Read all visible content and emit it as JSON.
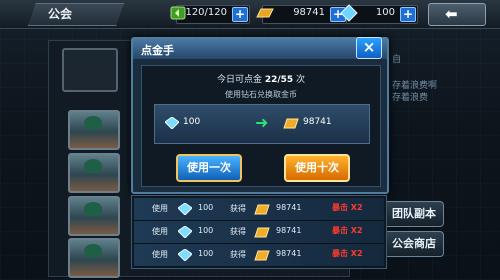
{
  "topbar": {
    "title": "公会",
    "stamina": "120/120",
    "gold": "98741",
    "diamond": "100",
    "plus": "+"
  },
  "background": {
    "faded_lines": [
      "自",
      "存着浪费啊",
      "存着浪费"
    ]
  },
  "side_buttons": {
    "team_dungeon": "团队副本",
    "guild_shop": "公会商店"
  },
  "dialog": {
    "title": "点金手",
    "close": "×",
    "today_label": "今日可点金",
    "today_count": "22/55",
    "today_unit": "次",
    "subtitle": "使用钻石兑换取金币",
    "exchange_diamond": "100",
    "exchange_gold": "98741",
    "btn_once": "使用一次",
    "btn_ten": "使用十次"
  },
  "results": [
    {
      "use_label": "使用",
      "diamond": "100",
      "gain_label": "获得",
      "gold": "98741",
      "crit": "暴击 X2"
    },
    {
      "use_label": "使用",
      "diamond": "100",
      "gain_label": "获得",
      "gold": "98741",
      "crit": "暴击 X2"
    },
    {
      "use_label": "使用",
      "diamond": "100",
      "gain_label": "获得",
      "gold": "98741",
      "crit": "暴击 X2"
    }
  ],
  "colors": {
    "accent_blue": "#1e6fd1",
    "crit_red": "#ff3b2e",
    "confirm_orange": "#ffb22d"
  },
  "icons": [
    "stamina-icon",
    "gold-bar-icon",
    "diamond-icon",
    "back-arrow-icon",
    "close-icon",
    "right-arrow-icon"
  ]
}
